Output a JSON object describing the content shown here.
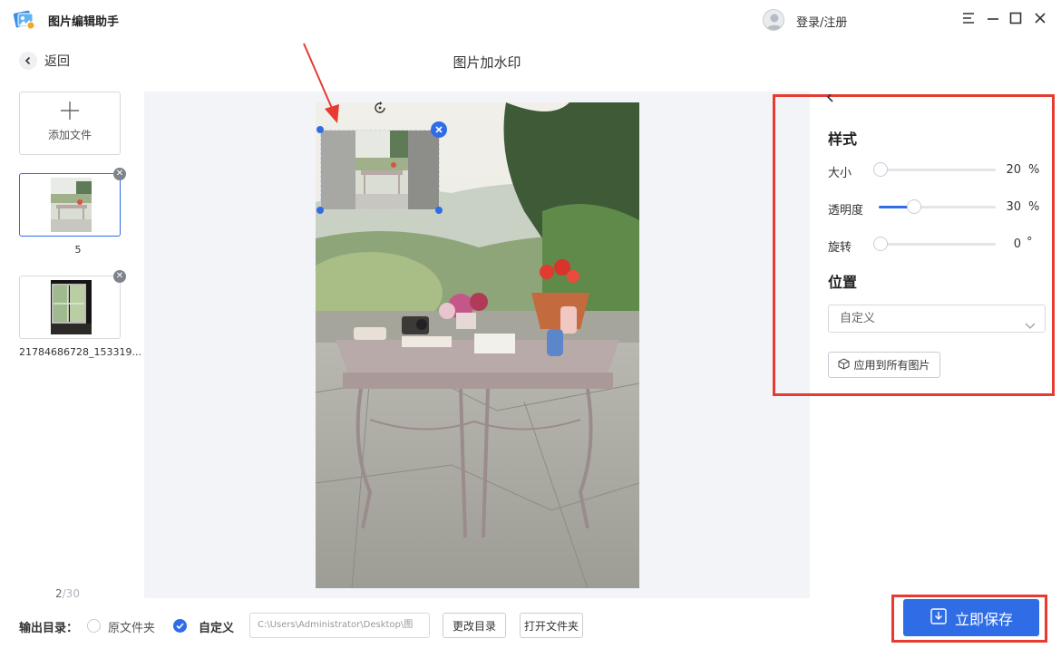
{
  "app": {
    "title": "图片编辑助手",
    "login_label": "登录/注册"
  },
  "nav": {
    "back_label": "返回",
    "page_title": "图片加水印"
  },
  "files": {
    "add_label": "添加文件",
    "items": [
      {
        "name": "5",
        "selected": true
      },
      {
        "name": "21784686728_153319...",
        "selected": false
      }
    ],
    "counter_current": "2",
    "counter_total": "/30"
  },
  "panel": {
    "style_title": "样式",
    "rows": [
      {
        "label": "大小",
        "value": "20",
        "unit": "%",
        "level": 0.0
      },
      {
        "label": "透明度",
        "value": "30",
        "unit": "%",
        "level": 0.3
      },
      {
        "label": "旋转",
        "value": "0",
        "unit": "°",
        "level": 0.0
      }
    ],
    "position_title": "位置",
    "position_value": "自定义",
    "apply_label": "应用到所有图片"
  },
  "bottom": {
    "output_label": "输出目录：",
    "option_original": "原文件夹",
    "option_custom": "自定义",
    "path_value": "C:\\Users\\Administrator\\Desktop\\图",
    "change_dir_label": "更改目录",
    "open_folder_label": "打开文件夹",
    "save_label": "立即保存"
  },
  "colors": {
    "accent": "#2f6de6",
    "highlight": "#e63a32"
  }
}
